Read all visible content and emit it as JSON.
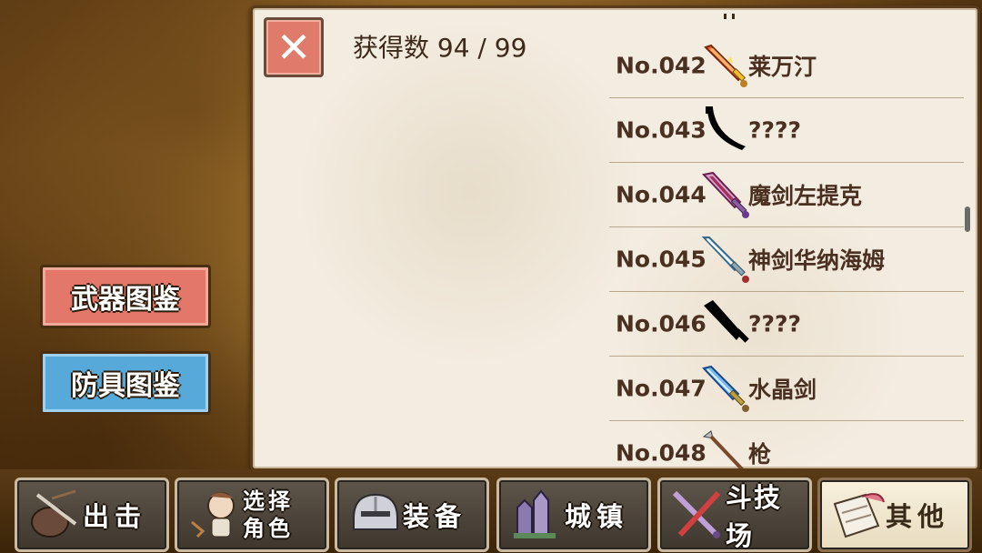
{
  "collection": {
    "count_label": "获得数  94 / 99",
    "close_symbol": "✕"
  },
  "items": [
    {
      "no": "No.042",
      "name": "莱万汀",
      "icon": "flame-sword-icon",
      "color": "#e05a2a"
    },
    {
      "no": "No.043",
      "name": "????",
      "icon": "unknown-blade-silhouette-icon",
      "color": "#000000"
    },
    {
      "no": "No.044",
      "name": "魔剑左提克",
      "icon": "demon-sword-icon",
      "color": "#a04070"
    },
    {
      "no": "No.045",
      "name": "神剑华纳海姆",
      "icon": "holy-sword-icon",
      "color": "#6aa0c0"
    },
    {
      "no": "No.046",
      "name": "????",
      "icon": "unknown-sword-silhouette-icon",
      "color": "#000000"
    },
    {
      "no": "No.047",
      "name": "水晶剑",
      "icon": "crystal-sword-icon",
      "color": "#4a8ad0"
    },
    {
      "no": "No.048",
      "name": "枪",
      "icon": "spear-icon",
      "color": "#7a4a2a"
    }
  ],
  "side_buttons": {
    "weapon": "武器图鉴",
    "armor": "防具图鉴"
  },
  "nav": [
    {
      "label": "出击",
      "icon": "sortie-bag-icon"
    },
    {
      "label_line1": "选择",
      "label_line2": "角色",
      "icon": "character-select-icon"
    },
    {
      "label": "装备",
      "icon": "helmet-icon"
    },
    {
      "label": "城镇",
      "icon": "town-castle-icon"
    },
    {
      "label": "斗技场",
      "icon": "crossed-swords-icon"
    },
    {
      "label": "其他",
      "icon": "scroll-quill-icon",
      "active": true
    }
  ],
  "colors": {
    "weapon_button": "#e2776a",
    "armor_button": "#56a9d8",
    "close_button": "#e07a6a",
    "panel": "#f3ece0"
  }
}
